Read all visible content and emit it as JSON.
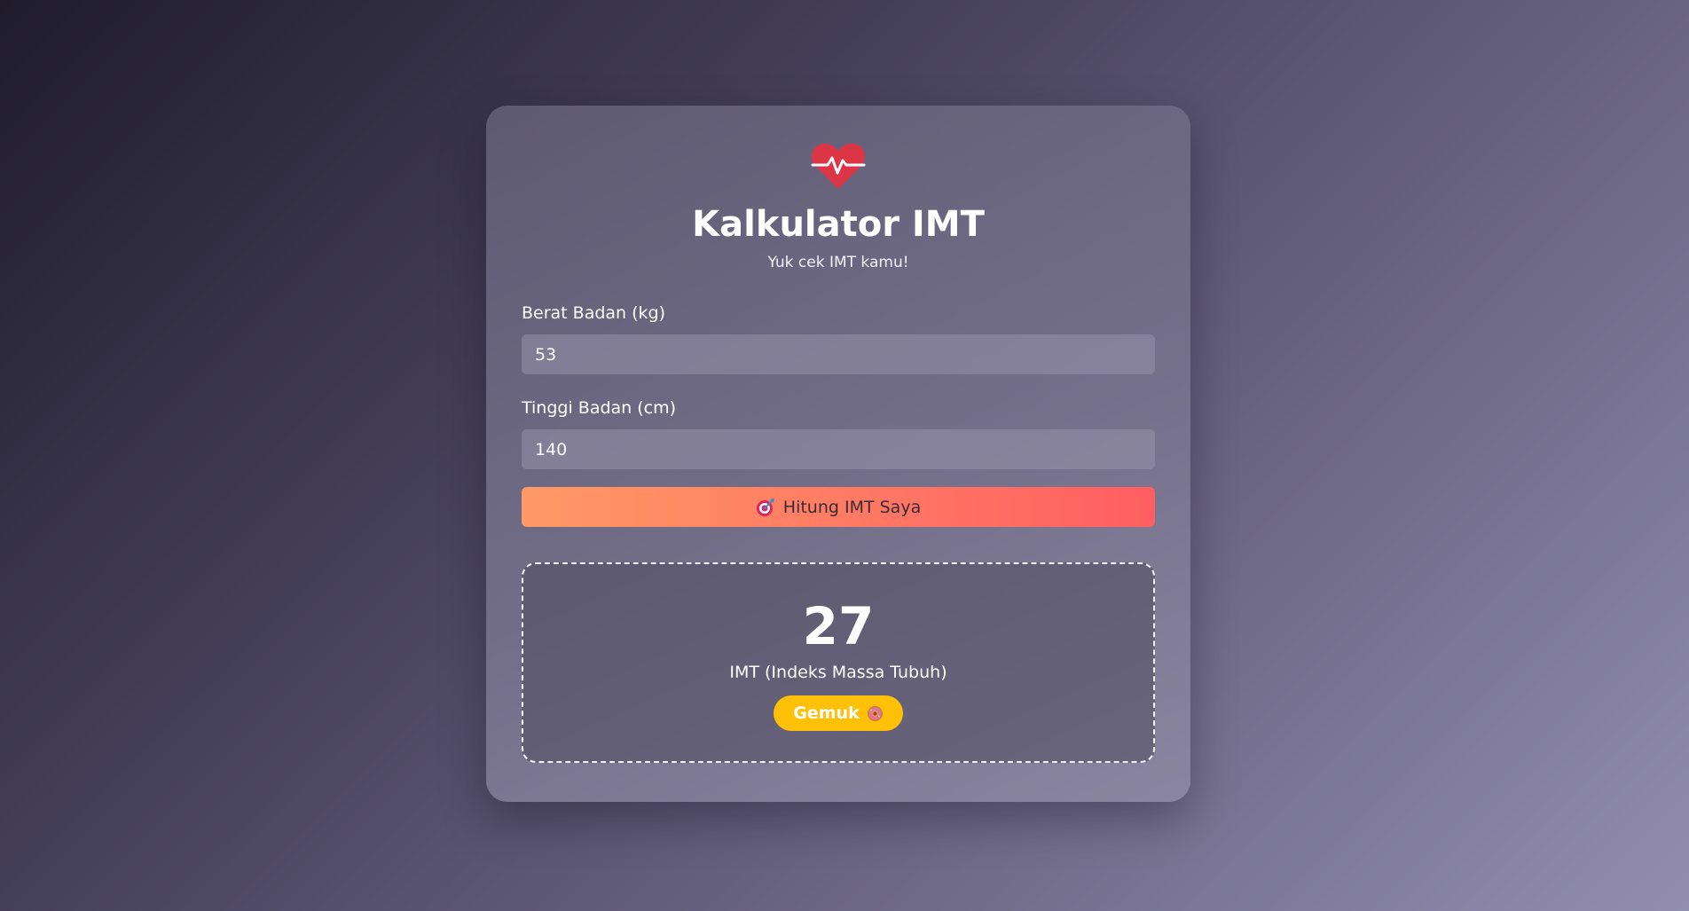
{
  "app": {
    "title": "Kalkulator IMT",
    "subtitle": "Yuk cek IMT kamu!",
    "logo_icon": "heart-pulse-icon",
    "logo_color": "#dc3545"
  },
  "form": {
    "weight": {
      "label": "Berat Badan (kg)",
      "value": "53"
    },
    "height": {
      "label": "Tinggi Badan (cm)",
      "value": "140"
    },
    "calculate_button": {
      "icon": "target-icon",
      "label": "Hitung IMT Saya"
    }
  },
  "result": {
    "value": "27",
    "label": "IMT (Indeks Massa Tubuh)",
    "category": {
      "label": "Gemuk",
      "icon": "donut-icon",
      "color": "#ffc107"
    }
  },
  "colors": {
    "button_gradient_start": "#ff9966",
    "button_gradient_end": "#ff5e62"
  }
}
